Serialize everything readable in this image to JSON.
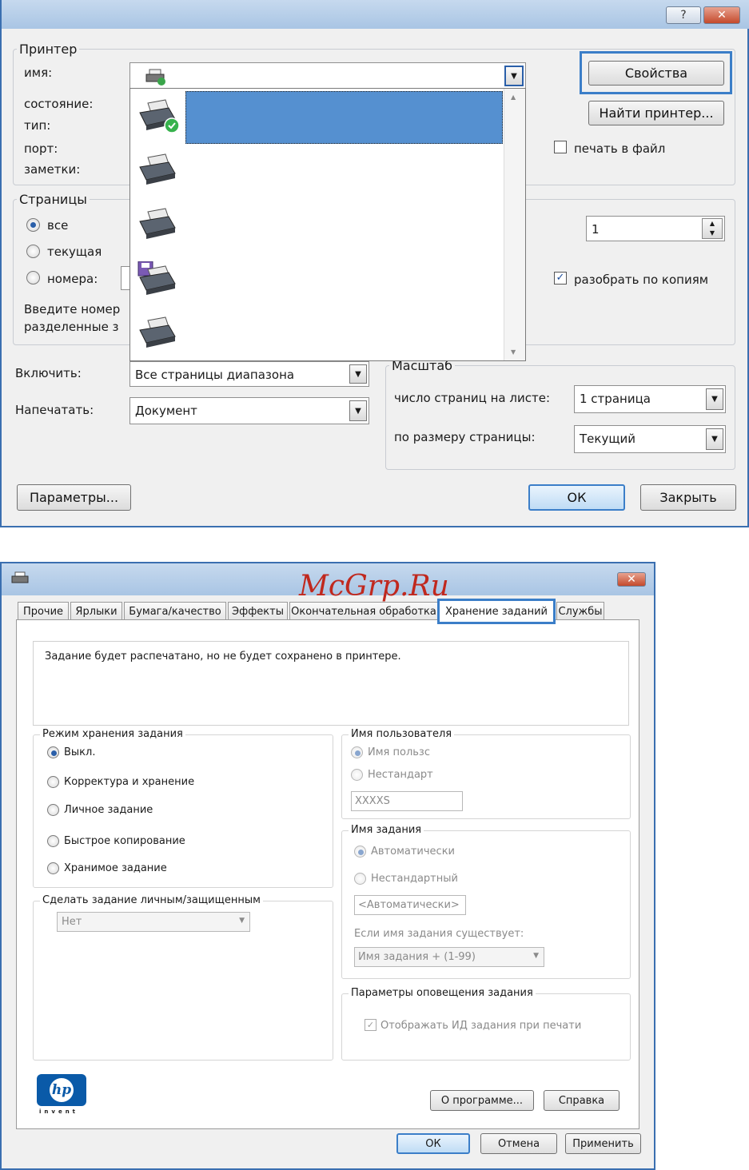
{
  "print_dialog": {
    "titlebar": {
      "help_label": "?",
      "close_label": "✕"
    },
    "printer_group": {
      "legend": "Принтер",
      "name_label": "имя:",
      "status_label": "состояние:",
      "type_label": "тип:",
      "port_label": "порт:",
      "notes_label": "заметки:"
    },
    "properties_button": "Свойства",
    "find_printer_button": "Найти принтер...",
    "print_to_file_label": "печать в файл",
    "print_to_file_checked": false,
    "pages_group": {
      "legend": "Страницы",
      "all_label": "все",
      "current_label": "текущая",
      "numbers_label": "номера:",
      "hint_line1": "Введите номер",
      "hint_line2": "разделенные з",
      "selected": "все"
    },
    "copies_value": "1",
    "collate_label": "разобрать по копиям",
    "collate_checked": true,
    "include_label": "Включить:",
    "include_value": "Все страницы диапазона",
    "print_what_label": "Напечатать:",
    "print_what_value": "Документ",
    "scale_group": {
      "legend": "Масштаб",
      "pages_per_sheet_label": "число страниц на листе:",
      "pages_per_sheet_value": "1 страница",
      "fit_label": "по размеру страницы:",
      "fit_value": "Текущий"
    },
    "options_button": "Параметры...",
    "ok_button": "ОК",
    "close_button": "Закрыть"
  },
  "properties_dialog": {
    "titlebar": {
      "close_label": "✕"
    },
    "watermark": "McGrp.Ru",
    "tabs": [
      {
        "label": "Прочие"
      },
      {
        "label": "Ярлыки"
      },
      {
        "label": "Бумага/качество"
      },
      {
        "label": "Эффекты"
      },
      {
        "label": "Окончательная обработка"
      },
      {
        "label": "Хранение заданий"
      },
      {
        "label": "Службы"
      }
    ],
    "active_tab": "Хранение заданий",
    "info_text": "Задание будет распечатано, но не будет сохранено в принтере.",
    "job_storage_mode": {
      "legend": "Режим хранения задания",
      "options": [
        "Выкл.",
        "Корректура и хранение",
        "Личное задание",
        "Быстрое копирование",
        "Хранимое задание"
      ],
      "selected": "Выкл."
    },
    "private_group": {
      "legend": "Сделать задание личным/защищенным",
      "value": "Нет"
    },
    "user_name": {
      "legend": "Имя пользователя",
      "option_user": "Имя пользс",
      "option_custom": "Нестандарт",
      "value": "XXXXS"
    },
    "job_name": {
      "legend": "Имя задания",
      "option_auto": "Автоматически",
      "option_custom": "Нестандартный",
      "value": "<Автоматически>",
      "exists_label": "Если имя задания существует:",
      "exists_value": "Имя задания + (1-99)"
    },
    "notification": {
      "legend": "Параметры оповещения задания",
      "show_id_label": "Отображать ИД задания при печати",
      "show_id_checked": true
    },
    "logo_text": "invent",
    "about_button": "О программе...",
    "help_button": "Справка",
    "ok_button": "ОК",
    "cancel_button": "Отмена",
    "apply_button": "Применить"
  },
  "colors": {
    "accent": "#3b7ec8",
    "selection": "#5590d0",
    "titlebar": "#b6cde8",
    "watermark": "#c0281e"
  }
}
